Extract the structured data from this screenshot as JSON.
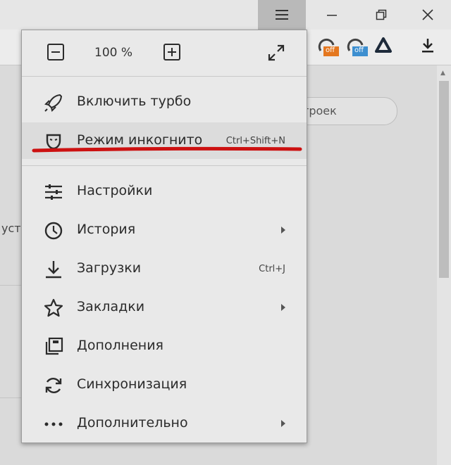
{
  "menu": {
    "zoom": {
      "value": "100 %"
    },
    "items": [
      {
        "label": "Включить турбо"
      },
      {
        "label": "Режим инкогнито",
        "shortcut": "Ctrl+Shift+N"
      },
      {
        "label": "Настройки"
      },
      {
        "label": "История"
      },
      {
        "label": "Загрузки",
        "shortcut": "Ctrl+J"
      },
      {
        "label": "Закладки"
      },
      {
        "label": "Дополнения"
      },
      {
        "label": "Синхронизация"
      },
      {
        "label": "Дополнительно"
      }
    ]
  },
  "toolbar": {
    "extensions": [
      {
        "badge": "off"
      },
      {
        "badge": "off"
      }
    ]
  },
  "page": {
    "search_fragment": "троек",
    "side_fragment": "уст"
  },
  "colors": {
    "highlight_mark": "#cc1111",
    "ext_badge_orange": "#e4771f",
    "ext_badge_blue": "#3d8fd0"
  }
}
